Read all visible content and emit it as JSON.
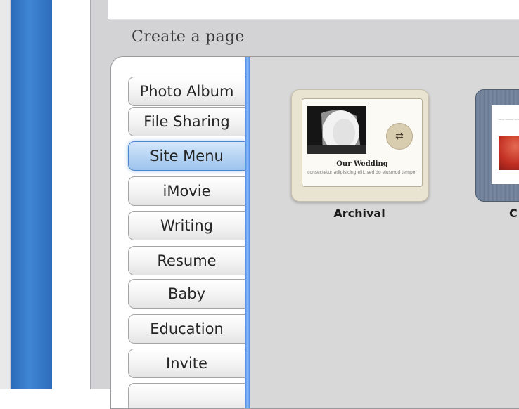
{
  "window": {
    "section_title": "Create a page"
  },
  "categories": [
    {
      "label": "Photo Album"
    },
    {
      "label": "File Sharing"
    },
    {
      "label": "Site Menu",
      "selected": true
    },
    {
      "label": "iMovie"
    },
    {
      "label": "Writing"
    },
    {
      "label": "Resume"
    },
    {
      "label": "Baby"
    },
    {
      "label": "Education"
    },
    {
      "label": "Invite"
    }
  ],
  "templates": [
    {
      "label": "Archival",
      "card_title": "Our Wedding",
      "card_subtitle": "consectetur adipisicing elit, sed do eiusmod tempor",
      "icon": "arrow-icon"
    },
    {
      "label": "C"
    }
  ],
  "colors": {
    "selected_accent": "#4c86cf",
    "separator_blue": "#3b7ed6"
  }
}
